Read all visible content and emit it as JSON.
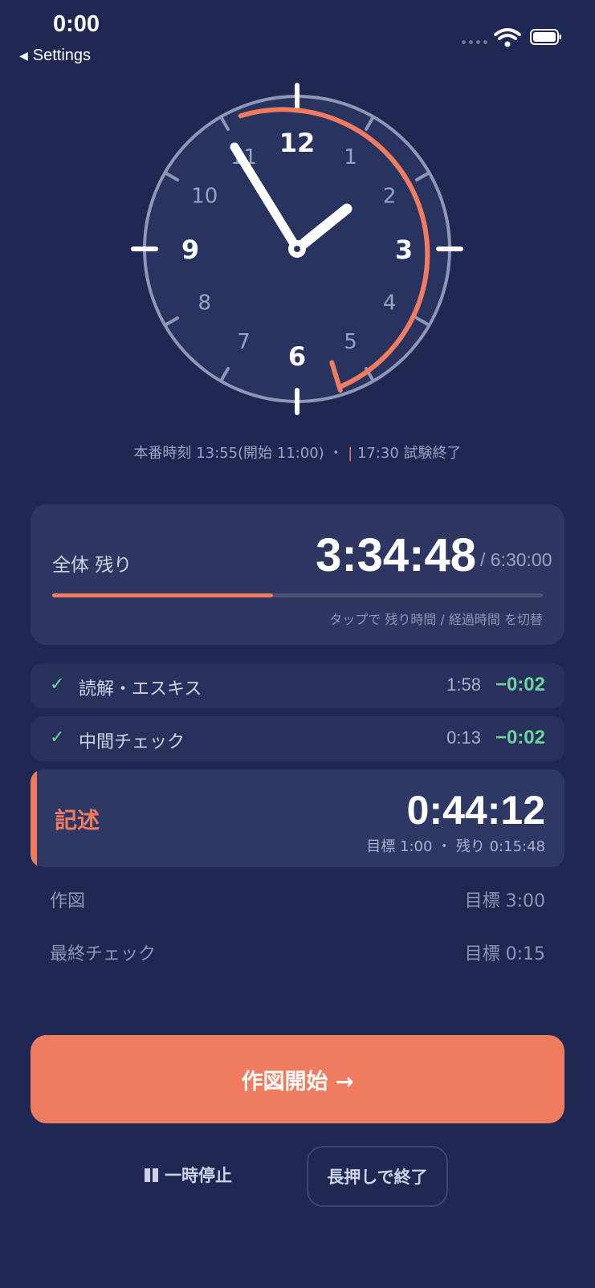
{
  "status_bar": {
    "time": "0:00",
    "back_label": "Settings"
  },
  "clock": {
    "numerals": [
      "12",
      "1",
      "2",
      "3",
      "4",
      "5",
      "6",
      "7",
      "8",
      "9",
      "10",
      "11"
    ],
    "caption": {
      "main": "本番時刻 13:55(開始 11:00) ・",
      "marker": "|",
      "end": "17:30 試験終了"
    },
    "colors": {
      "accent": "#f07c5f",
      "ring": "#8f97b5",
      "hands": "#ffffff"
    }
  },
  "overall": {
    "label": "全体 残り",
    "time": "3:34:48",
    "total": "/ 6:30:00",
    "progress": 0.45,
    "hint": "タップで 残り時間 / 経過時間 を切替"
  },
  "phases_done": [
    {
      "name": "読解・エスキス",
      "duration": "1:58",
      "delta": "−0:02"
    },
    {
      "name": "中間チェック",
      "duration": "0:13",
      "delta": "−0:02"
    }
  ],
  "phase_active": {
    "name": "記述",
    "time": "0:44:12",
    "sub": "目標 1:00 ・ 残り 0:15:48"
  },
  "phases_next": [
    {
      "name": "作図",
      "target": "目標 3:00"
    },
    {
      "name": "最終チェック",
      "target": "目標 0:15"
    }
  ],
  "actions": {
    "primary": "作図開始 →",
    "pause": "一時停止",
    "end": "長押しで終了"
  }
}
